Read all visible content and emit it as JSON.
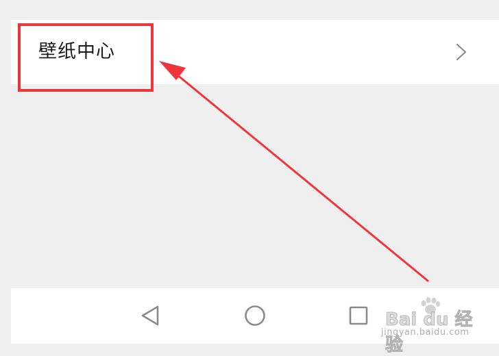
{
  "settings_row": {
    "label": "壁纸中心",
    "chevron_icon": "chevron-right-icon"
  },
  "annotation": {
    "color": "#f0353a"
  },
  "nav_bar": {
    "back_icon": "triangle-back-icon",
    "home_icon": "circle-home-icon",
    "recents_icon": "square-recents-icon"
  },
  "watermark": {
    "logo_text": "Bai du 经验",
    "url_text": "jingyan.baidu.com"
  }
}
